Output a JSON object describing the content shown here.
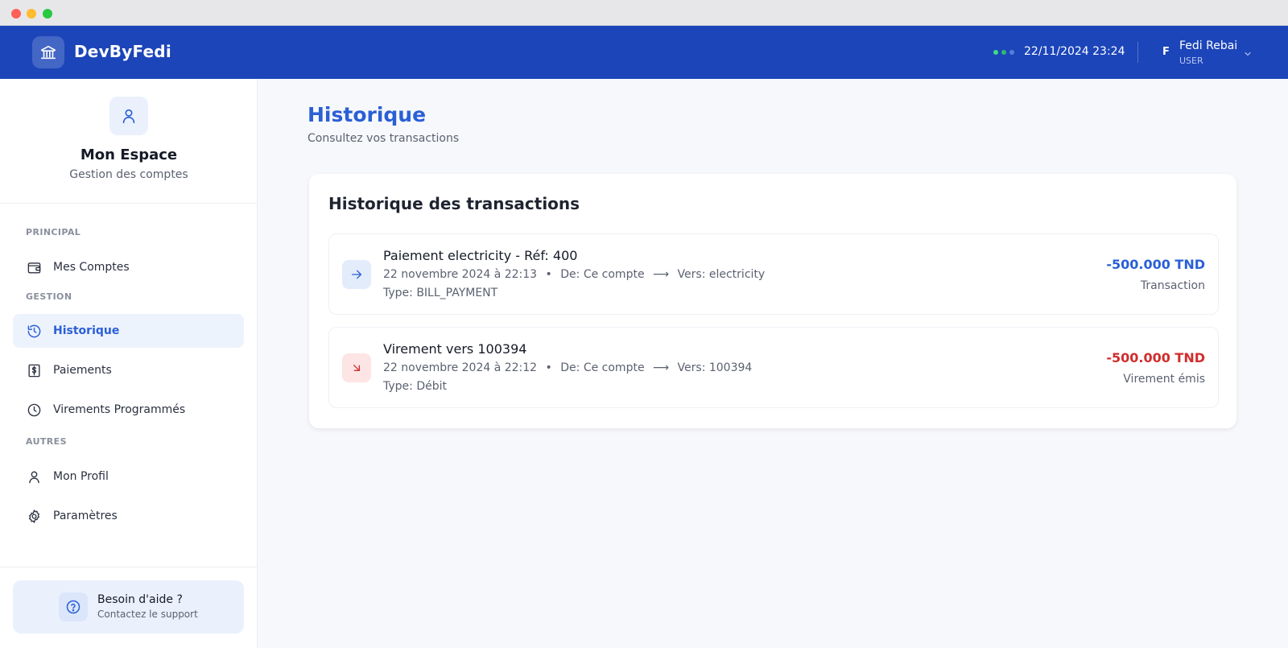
{
  "window": {
    "controls": [
      "close",
      "minimize",
      "maximize"
    ]
  },
  "header": {
    "brand_icon": "bank-icon",
    "brand": "DevByFedi",
    "status_colors": [
      "#3ddc84",
      "#2fb872",
      "#5a7fd6"
    ],
    "datetime": "22/11/2024 23:24",
    "user": {
      "initial": "F",
      "name": "Fedi Rebai",
      "role": "USER",
      "menu_icon": "chevron-down-icon"
    }
  },
  "sidebar": {
    "profile_icon": "user-icon",
    "title": "Mon Espace",
    "subtitle": "Gestion des comptes",
    "sections": [
      {
        "label": "PRINCIPAL",
        "items": [
          {
            "label": "Mes Comptes",
            "icon": "wallet-icon",
            "active": false
          }
        ]
      },
      {
        "label": "GESTION",
        "items": [
          {
            "label": "Historique",
            "icon": "history-icon",
            "active": true
          },
          {
            "label": "Paiements",
            "icon": "receipt-icon",
            "active": false
          },
          {
            "label": "Virements Programmés",
            "icon": "clock-icon",
            "active": false
          }
        ]
      },
      {
        "label": "AUTRES",
        "items": [
          {
            "label": "Mon Profil",
            "icon": "user-icon",
            "active": false
          },
          {
            "label": "Paramètres",
            "icon": "gear-icon",
            "active": false
          }
        ]
      }
    ],
    "help": {
      "icon": "help-circle-icon",
      "title": "Besoin d'aide ?",
      "subtitle": "Contactez le support"
    }
  },
  "main": {
    "title": "Historique",
    "subtitle": "Consultez vos transactions",
    "card_title": "Historique des transactions",
    "transactions": [
      {
        "icon": "arrow-right-icon",
        "title": "Paiement electricity - Réf: 400",
        "date": "22 novembre 2024 à 22:13",
        "bullet": "•",
        "from": "De: Ce compte",
        "arrow": "⟶",
        "to": "Vers: electricity",
        "type": "Type: BILL_PAYMENT",
        "amount": "-500.000 TND",
        "kind": "Transaction",
        "color": "#2a5fd6",
        "icon_bg": "#e3ecfb"
      },
      {
        "icon": "arrow-down-right-icon",
        "title": "Virement vers 100394",
        "date": "22 novembre 2024 à 22:12",
        "bullet": "•",
        "from": "De: Ce compte",
        "arrow": "⟶",
        "to": "Vers: 100394",
        "type": "Type: Débit",
        "amount": "-500.000 TND",
        "kind": "Virement émis",
        "color": "#d12d2d",
        "icon_bg": "#fde5e5"
      }
    ]
  }
}
